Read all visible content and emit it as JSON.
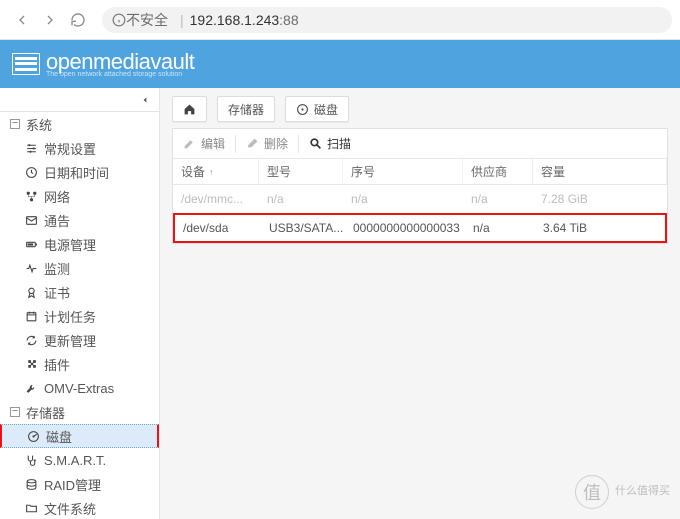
{
  "browser": {
    "insecure_label": "不安全",
    "host": "192.168.1.243",
    "port": ":88"
  },
  "brand": {
    "name": "openmediavault",
    "tagline": "The open network attached storage solution"
  },
  "breadcrumbs": {
    "storage": "存储器",
    "disks": "磁盘"
  },
  "toolbar": {
    "edit": "编辑",
    "delete": "删除",
    "scan": "扫描"
  },
  "sidebar": {
    "system": "系统",
    "general": "常规设置",
    "datetime": "日期和时间",
    "network": "网络",
    "notification": "通告",
    "power": "电源管理",
    "monitoring": "监测",
    "certs": "证书",
    "scheduled": "计划任务",
    "update": "更新管理",
    "plugins": "插件",
    "omv_extras": "OMV-Extras",
    "storage": "存储器",
    "disks": "磁盘",
    "smart": "S.M.A.R.T.",
    "raid": "RAID管理",
    "filesystems": "文件系统"
  },
  "table": {
    "cols": {
      "device": "设备",
      "model": "型号",
      "serial": "序号",
      "vendor": "供应商",
      "capacity": "容量"
    },
    "rows": [
      {
        "device": "/dev/mmc...",
        "model": "n/a",
        "serial": "n/a",
        "vendor": "n/a",
        "capacity": "7.28 GiB"
      },
      {
        "device": "/dev/sda",
        "model": "USB3/SATA...",
        "serial": "0000000000000033",
        "vendor": "n/a",
        "capacity": "3.64 TiB"
      }
    ]
  },
  "watermark": {
    "icon": "值",
    "line1": "什么值得买",
    "line2": ""
  }
}
